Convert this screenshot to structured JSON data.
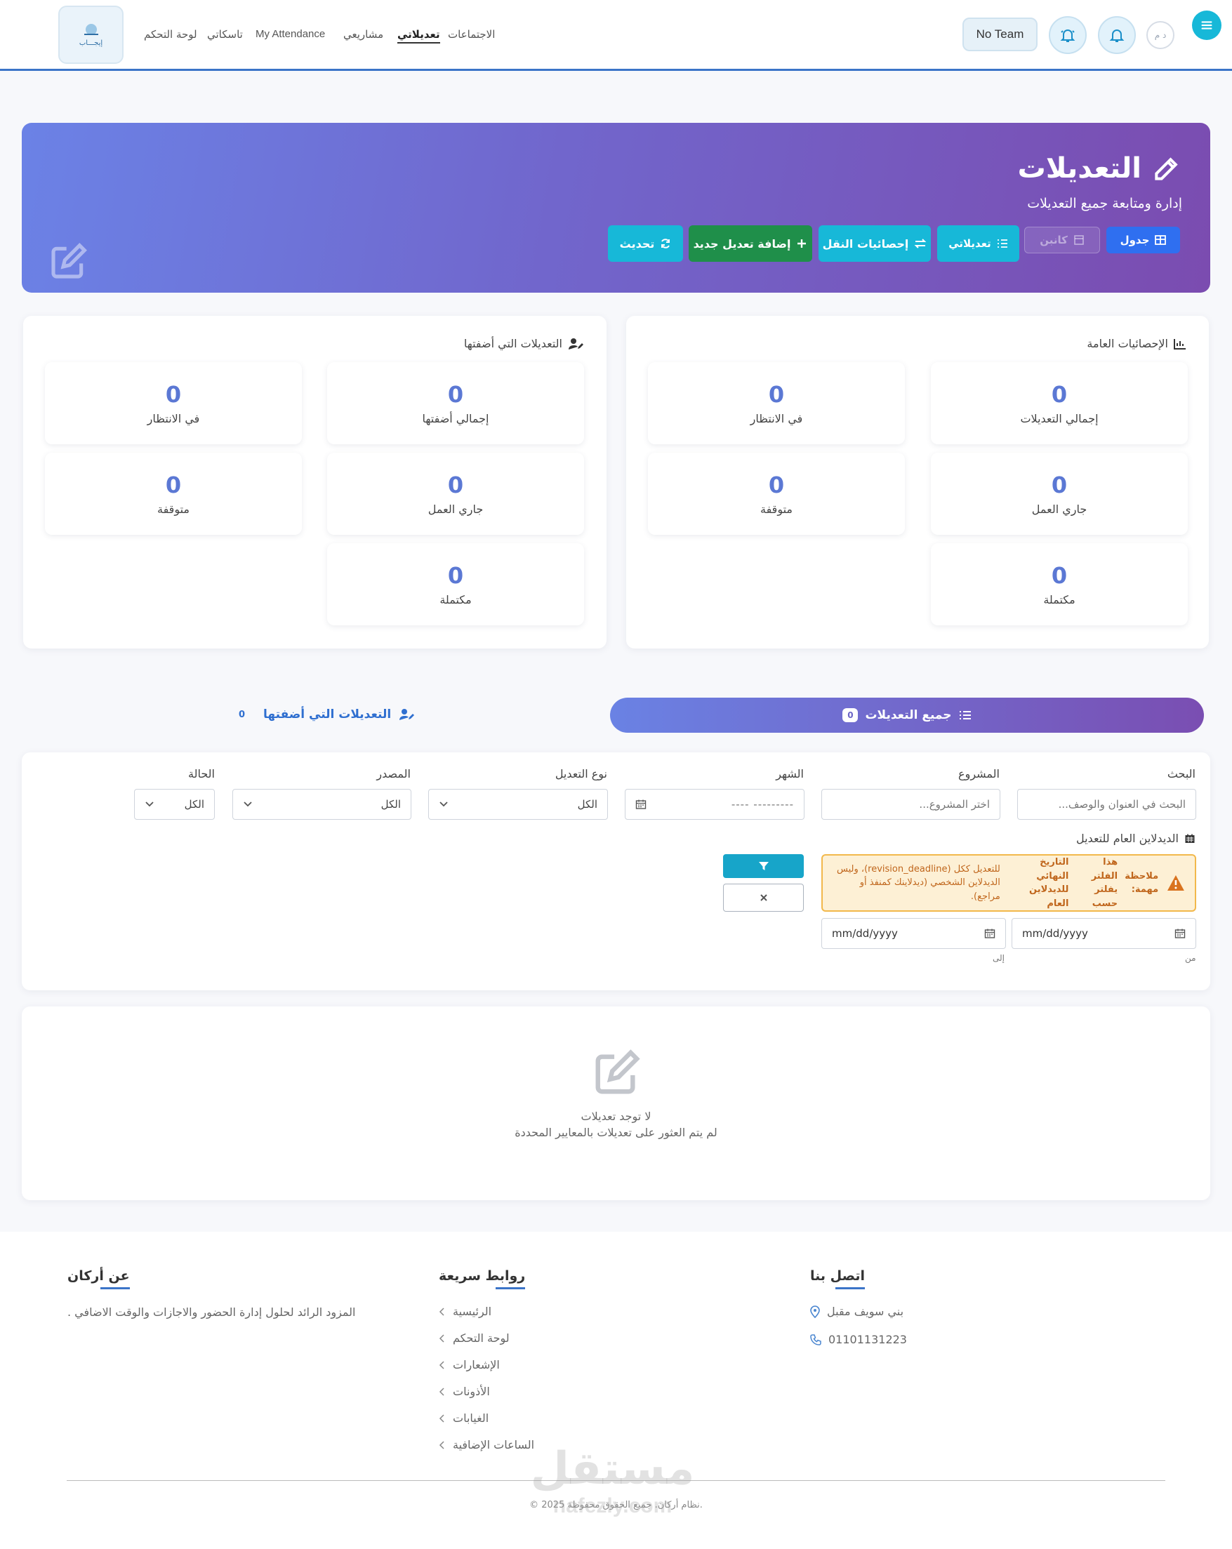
{
  "nav": {
    "avatar_initials": "د م",
    "team": "No Team",
    "links": [
      "الاجتماعات",
      "تعديلاتي",
      "مشاريعي",
      "My Attendance",
      "تاسكاتي",
      "لوحة التحكم"
    ],
    "logo_text": "إيجـــاب"
  },
  "hero": {
    "title": "التعديلات",
    "subtitle": "إدارة ومتابعة جميع التعديلات",
    "buttons": {
      "table": "جدول",
      "kanban": "كانبن",
      "mine": "تعديلاتي",
      "transfer_stats": "إحصائيات النقل",
      "add_new": "إضافة تعديل جديد",
      "refresh": "تحديث"
    }
  },
  "stats": {
    "general": {
      "title": "الإحصائيات العامة",
      "items": [
        {
          "label": "إجمالي التعديلات",
          "value": "0"
        },
        {
          "label": "في الانتظار",
          "value": "0"
        },
        {
          "label": "جاري العمل",
          "value": "0"
        },
        {
          "label": "متوقفة",
          "value": "0"
        },
        {
          "label": "مكتملة",
          "value": "0"
        }
      ]
    },
    "mine": {
      "title": "التعديلات التي أضفتها",
      "items": [
        {
          "label": "إجمالي أضفتها",
          "value": "0"
        },
        {
          "label": "في الانتظار",
          "value": "0"
        },
        {
          "label": "جاري العمل",
          "value": "0"
        },
        {
          "label": "متوقفة",
          "value": "0"
        },
        {
          "label": "مكتملة",
          "value": "0"
        }
      ]
    }
  },
  "tabs": {
    "all": {
      "label": "جميع التعديلات",
      "count": "0"
    },
    "mine": {
      "label": "التعديلات التي أضفتها",
      "count": "0"
    }
  },
  "filters": {
    "search": {
      "label": "البحث",
      "placeholder": "البحث في العنوان والوصف..."
    },
    "project": {
      "label": "المشروع",
      "placeholder": "اختر المشروع..."
    },
    "month": {
      "label": "الشهر",
      "value": "--------- ----"
    },
    "type": {
      "label": "نوع التعديل",
      "value": "الكل"
    },
    "source": {
      "label": "المصدر",
      "value": "الكل"
    },
    "status": {
      "label": "الحالة",
      "value": "الكل"
    },
    "deadline": {
      "label": "الديدلاين العام للتعديل",
      "from_label": "من",
      "to_label": "إلى",
      "from_placeholder": "mm/dd/yyyy",
      "to_placeholder": "mm/dd/yyyy"
    },
    "note": {
      "prefix": "ملاحظة مهمة:",
      "c1": "هذا الفلتر يفلتر حسب",
      "c2": "التاريخ النهائي للديدلاين العام",
      "c3": "للتعديل ككل (revision_deadline)، وليس الديدلاين الشخصي (ديدلاينك كمنفذ أو مراجع)."
    }
  },
  "empty": {
    "title": "لا توجد تعديلات",
    "subtitle": "لم يتم العثور على تعديلات بالمعايير المحددة"
  },
  "footer": {
    "about": {
      "title": "عن أركان",
      "text": "المزود الرائد لحلول إدارة الحضور والاجازات والوقت الاضافي ."
    },
    "links": {
      "title": "روابط سريعة",
      "items": [
        "الرئيسية",
        "لوحة التحكم",
        "الإشعارات",
        "الأذونات",
        "الغيابات",
        "الساعات الإضافية"
      ]
    },
    "contact": {
      "title": "اتصل بنا",
      "address": "بني سويف مقبل",
      "phone": "01101131223"
    },
    "copyright": "© 2025 نظام أركان. جميع الحقوق محفوظة.",
    "watermark_ar": "مستقل",
    "watermark_en": "nafezly.com"
  },
  "colors": {
    "accent": "#3b74c8",
    "hero_start": "#6b82e6",
    "hero_end": "#7b4cb0",
    "stat_number": "#5b78d4",
    "add_button": "#1f8f4a",
    "cyan_button": "#17b8d8",
    "warning_bg": "#fdf0d5"
  }
}
